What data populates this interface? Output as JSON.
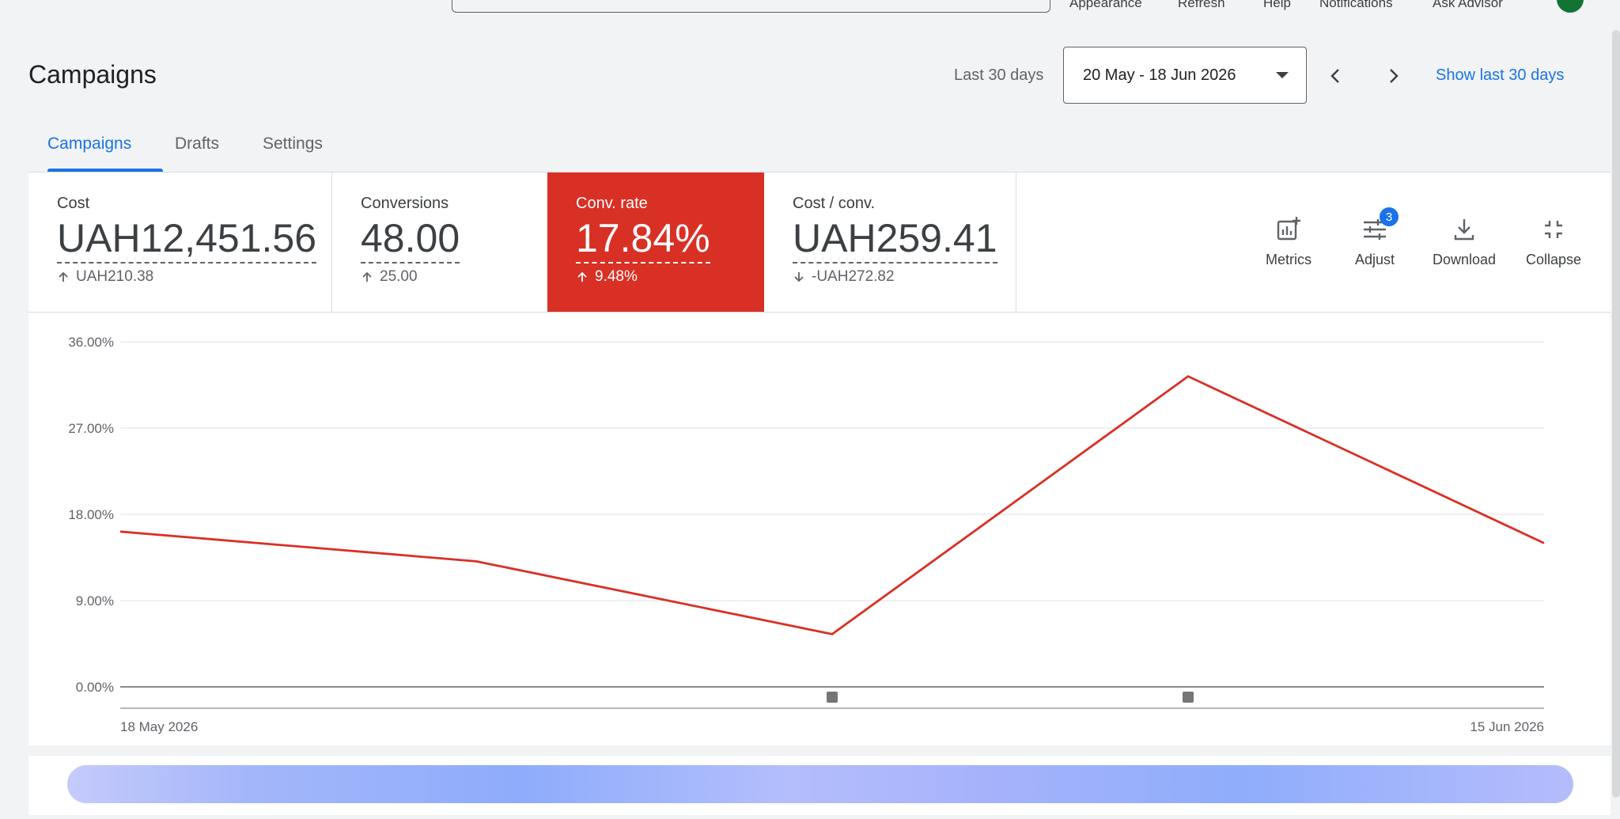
{
  "topbar": {
    "items": [
      "Appearance",
      "Refresh",
      "Help",
      "Notifications",
      "Ask Advisor"
    ]
  },
  "header": {
    "title": "Campaigns",
    "date_label": "Last 30 days",
    "date_range": "20 May - 18 Jun 2026",
    "show_last": "Show last 30 days"
  },
  "tabs": [
    {
      "label": "Campaigns",
      "active": true
    },
    {
      "label": "Drafts",
      "active": false
    },
    {
      "label": "Settings",
      "active": false
    }
  ],
  "metrics": [
    {
      "label": "Cost",
      "value": "UAH12,451.56",
      "delta": "UAH210.38",
      "direction": "up",
      "selected": false
    },
    {
      "label": "Conversions",
      "value": "48.00",
      "delta": "25.00",
      "direction": "up",
      "selected": false
    },
    {
      "label": "Conv. rate",
      "value": "17.84%",
      "delta": "9.48%",
      "direction": "up",
      "selected": true
    },
    {
      "label": "Cost / conv.",
      "value": "UAH259.41",
      "delta": "-UAH272.82",
      "direction": "down",
      "selected": false
    }
  ],
  "tools": {
    "metrics_label": "Metrics",
    "adjust_label": "Adjust",
    "adjust_badge": "3",
    "download_label": "Download",
    "collapse_label": "Collapse"
  },
  "colors": {
    "accent": "#1a73e8",
    "selected_metric": "#d93025",
    "series_line": "#d93025"
  },
  "chart_data": {
    "type": "line",
    "x": [
      "18 May 2026",
      "25 May 2026",
      "1 Jun 2026",
      "8 Jun 2026",
      "15 Jun 2026"
    ],
    "series": [
      {
        "values": [
          16.2,
          13.1,
          5.5,
          32.4,
          15.0
        ]
      }
    ],
    "y_ticks": [
      "0.00%",
      "9.00%",
      "18.00%",
      "27.00%",
      "36.00%"
    ],
    "ylim": [
      0,
      36
    ],
    "x_tick_labels": [
      "18 May 2026",
      "15 Jun 2026"
    ],
    "annotation_markers_at": [
      "1 Jun 2026",
      "8 Jun 2026"
    ],
    "grid": true
  }
}
